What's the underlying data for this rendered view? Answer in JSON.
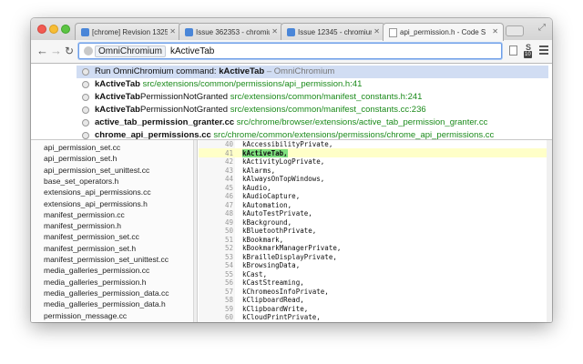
{
  "tabs": [
    {
      "title": "[chrome] Revision 13253",
      "favicon": "chromium-favicon-icon"
    },
    {
      "title": "Issue 362353 - chromium",
      "favicon": "issue-favicon-icon"
    },
    {
      "title": "Issue 12345 - chromium",
      "favicon": "issue-favicon-icon"
    },
    {
      "title": "api_permission.h - Code S",
      "favicon": "document-favicon-icon",
      "active": true
    }
  ],
  "toolbar": {
    "keyword": "OmniChromium",
    "query": "kActiveTab",
    "badge": "10"
  },
  "suggestions": [
    {
      "pre": "Run OmniChromium command: ",
      "bold": "kActiveTab",
      "boldrest": "",
      "url": "",
      "desc": " – OmniChromium"
    },
    {
      "pre": "",
      "bold": "kActiveTab",
      "boldrest": "",
      "url": " src/extensions/common/permissions/api_permission.h:41",
      "desc": ""
    },
    {
      "pre": "",
      "bold": "kActiveTab",
      "boldrest": "PermissionNotGranted",
      "url": " src/extensions/common/manifest_constants.h:241",
      "desc": ""
    },
    {
      "pre": "",
      "bold": "kActiveTab",
      "boldrest": "PermissionNotGranted",
      "url": " src/extensions/common/manifest_constants.cc:236",
      "desc": ""
    },
    {
      "pre": "",
      "bold": "active_tab_permission_granter.cc",
      "boldrest": "",
      "url": " src/chrome/browser/extensions/active_tab_permission_granter.cc",
      "desc": ""
    },
    {
      "pre": "",
      "bold": "chrome_api_permissions.cc",
      "boldrest": "",
      "url": " src/chrome/common/extensions/permissions/chrome_api_permissions.cc",
      "desc": ""
    }
  ],
  "files": [
    "api_permission_set.cc",
    "api_permission_set.h",
    "api_permission_set_unittest.cc",
    "base_set_operators.h",
    "extensions_api_permissions.cc",
    "extensions_api_permissions.h",
    "manifest_permission.cc",
    "manifest_permission.h",
    "manifest_permission_set.cc",
    "manifest_permission_set.h",
    "manifest_permission_set_unittest.cc",
    "media_galleries_permission.cc",
    "media_galleries_permission.h",
    "media_galleries_permission_data.cc",
    "media_galleries_permission_data.h",
    "permission_message.cc"
  ],
  "code_lines": [
    {
      "n": "40",
      "text": "kAccessibilityPrivate,"
    },
    {
      "n": "41",
      "text": "kActiveTab,",
      "highlight": true
    },
    {
      "n": "42",
      "text": "kActivityLogPrivate,"
    },
    {
      "n": "43",
      "text": "kAlarms,"
    },
    {
      "n": "44",
      "text": "kAlwaysOnTopWindows,"
    },
    {
      "n": "45",
      "text": "kAudio,"
    },
    {
      "n": "46",
      "text": "kAudioCapture,"
    },
    {
      "n": "47",
      "text": "kAutomation,"
    },
    {
      "n": "48",
      "text": "kAutoTestPrivate,"
    },
    {
      "n": "49",
      "text": "kBackground,"
    },
    {
      "n": "50",
      "text": "kBluetoothPrivate,"
    },
    {
      "n": "51",
      "text": "kBookmark,"
    },
    {
      "n": "52",
      "text": "kBookmarkManagerPrivate,"
    },
    {
      "n": "53",
      "text": "kBrailleDisplayPrivate,"
    },
    {
      "n": "54",
      "text": "kBrowsingData,"
    },
    {
      "n": "55",
      "text": "kCast,"
    },
    {
      "n": "56",
      "text": "kCastStreaming,"
    },
    {
      "n": "57",
      "text": "kChromeosInfoPrivate,"
    },
    {
      "n": "58",
      "text": "kClipboardRead,"
    },
    {
      "n": "59",
      "text": "kClipboardWrite,"
    },
    {
      "n": "60",
      "text": "kCloudPrintPrivate,"
    }
  ]
}
